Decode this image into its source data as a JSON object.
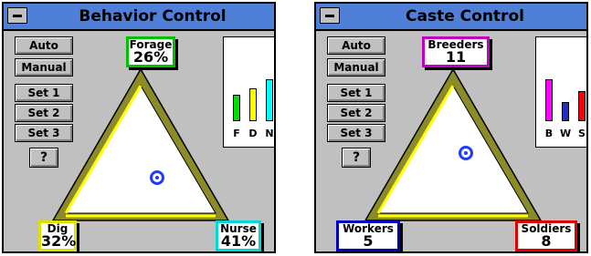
{
  "behavior": {
    "title": "Behavior Control",
    "buttons": [
      "Auto",
      "Manual",
      "Set 1",
      "Set 2",
      "Set 3"
    ],
    "help": "?",
    "forage": {
      "name": "Forage",
      "value": "26%",
      "color": "#00c000"
    },
    "dig": {
      "name": "Dig",
      "value": "32%",
      "color": "#e0e000"
    },
    "nurse": {
      "name": "Nurse",
      "value": "41%",
      "color": "#00e0e0"
    },
    "bars": [
      {
        "label": "F",
        "value": 26,
        "color": "#00e000"
      },
      {
        "label": "D",
        "value": 32,
        "color": "#ffff00"
      },
      {
        "label": "N",
        "value": 41,
        "color": "#00ffff"
      }
    ]
  },
  "caste": {
    "title": "Caste Control",
    "buttons": [
      "Auto",
      "Manual",
      "Set 1",
      "Set 2",
      "Set 3"
    ],
    "help": "?",
    "breeders": {
      "name": "Breeders",
      "value": "11",
      "color": "#c000c0"
    },
    "workers": {
      "name": "Workers",
      "value": "5",
      "color": "#0000c0"
    },
    "soldiers": {
      "name": "Soldiers",
      "value": "8",
      "color": "#e00000"
    },
    "bars": [
      {
        "label": "B",
        "value": 11,
        "color": "#ff00ff"
      },
      {
        "label": "W",
        "value": 5,
        "color": "#2030c0"
      },
      {
        "label": "S",
        "value": 8,
        "color": "#ff0000"
      }
    ]
  }
}
